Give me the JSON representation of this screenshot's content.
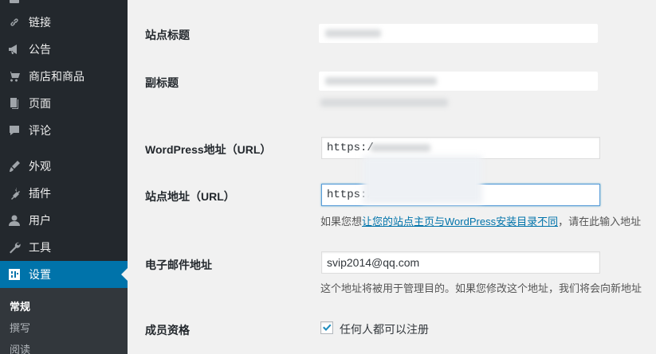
{
  "sidebar": {
    "items": [
      {
        "label": "链接",
        "icon": "link-icon"
      },
      {
        "label": "公告",
        "icon": "megaphone-icon"
      },
      {
        "label": "商店和商品",
        "icon": "cart-icon"
      },
      {
        "label": "页面",
        "icon": "pages-icon"
      },
      {
        "label": "评论",
        "icon": "comment-icon"
      },
      {
        "label": "外观",
        "icon": "brush-icon"
      },
      {
        "label": "插件",
        "icon": "plugin-icon"
      },
      {
        "label": "用户",
        "icon": "user-icon"
      },
      {
        "label": "工具",
        "icon": "wrench-icon"
      },
      {
        "label": "设置",
        "icon": "settings-icon"
      }
    ],
    "submenu": [
      "常规",
      "撰写",
      "阅读"
    ],
    "active_color": "#0073aa"
  },
  "form": {
    "site_title_label": "站点标题",
    "tagline_label": "副标题",
    "wp_url_label": "WordPress地址（URL）",
    "wp_url_value": "https:/",
    "site_url_label": "站点地址（URL）",
    "site_url_value": "https:/",
    "site_url_desc_prefix": "如果您想",
    "site_url_desc_link": "让您的站点主页与WordPress安装目录不同",
    "site_url_desc_suffix": "，请在此输入地址",
    "email_label": "电子邮件地址",
    "email_value": "svip2014@qq.com",
    "email_desc": "这个地址将被用于管理目的。如果您修改这个地址，我们将会向新地址",
    "membership_label": "成员资格",
    "membership_checkbox_label": "任何人都可以注册"
  }
}
